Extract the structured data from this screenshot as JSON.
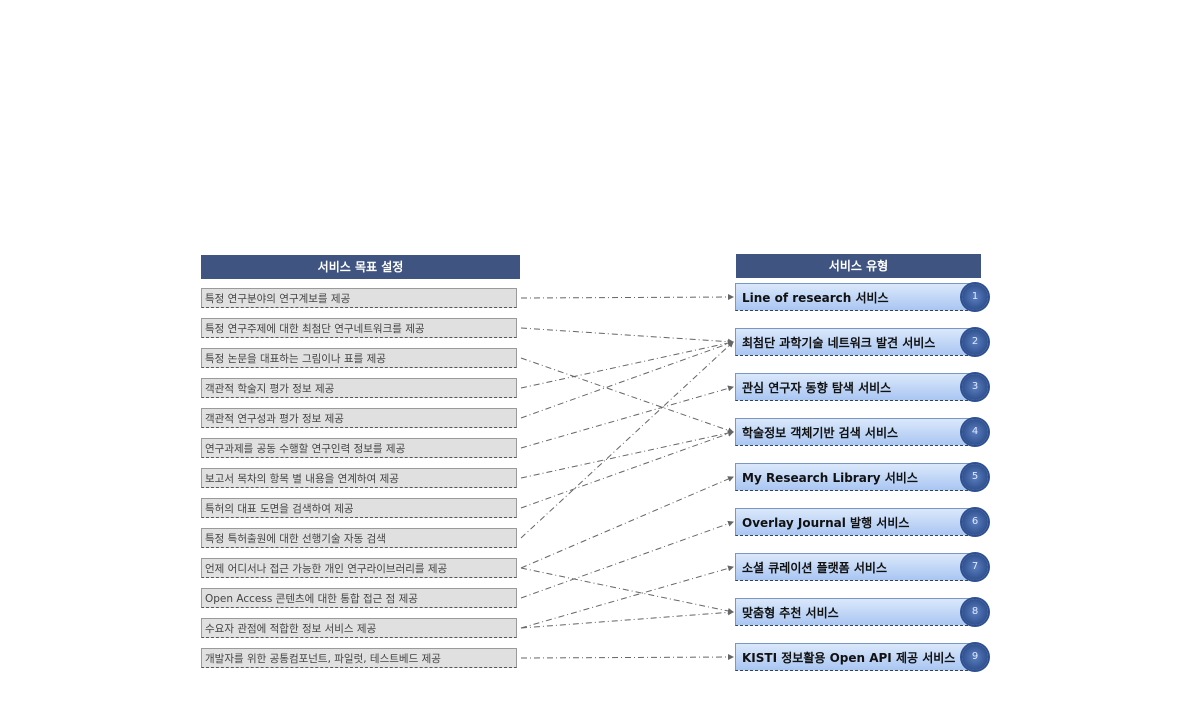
{
  "left_header": "서비스 목표 설정",
  "right_header": "서비스 유형",
  "goals": [
    "특정 연구분야의 연구계보를 제공",
    "특정 연구주제에 대한 최첨단 연구네트워크를 제공",
    "특정 논문을 대표하는 그림이나 표를 제공",
    "객관적 학술지 평가 정보 제공",
    "객관적 연구성과 평가 정보 제공",
    "연구과제를 공동 수행할 연구인력 정보를 제공",
    "보고서 목차의 항목 별 내용을 연계하여 제공",
    "특허의 대표 도면을 검색하여 제공",
    "특정 특허출원에 대한 선행기술 자동 검색",
    "언제 어디서나 접근 가능한 개인 연구라이브러리를 제공",
    "Open Access 콘텐츠에 대한 통합 접근 점 제공",
    "수요자 관점에 적합한 정보 서비스 제공",
    "개발자를 위한 공통컴포넌트, 파일럿, 테스트베드 제공"
  ],
  "services": [
    {
      "label": "Line of research 서비스",
      "num": "1"
    },
    {
      "label": "최첨단 과학기술 네트워크 발견 서비스",
      "num": "2"
    },
    {
      "label": "관심 연구자 동향 탐색 서비스",
      "num": "3"
    },
    {
      "label": "학술정보 객체기반 검색 서비스",
      "num": "4"
    },
    {
      "label": "My Research Library 서비스",
      "num": "5"
    },
    {
      "label": "Overlay Journal 발행 서비스",
      "num": "6"
    },
    {
      "label": "소셜 큐레이션 플랫폼 서비스",
      "num": "7"
    },
    {
      "label": "맞춤형 추천 서비스",
      "num": "8"
    },
    {
      "label": "KISTI 정보활용 Open API 제공 서비스",
      "num": "9"
    }
  ],
  "links": [
    [
      1,
      1
    ],
    [
      2,
      2
    ],
    [
      3,
      4
    ],
    [
      4,
      2
    ],
    [
      5,
      2
    ],
    [
      6,
      3
    ],
    [
      7,
      4
    ],
    [
      8,
      4
    ],
    [
      9,
      2
    ],
    [
      10,
      5
    ],
    [
      10,
      8
    ],
    [
      11,
      6
    ],
    [
      12,
      7
    ],
    [
      12,
      8
    ],
    [
      13,
      9
    ]
  ],
  "colors": {
    "header": "#3f5480",
    "goal_box": "#e0e0e0",
    "service_box": "#a9c6f2",
    "badge": "#1f3d7a"
  }
}
